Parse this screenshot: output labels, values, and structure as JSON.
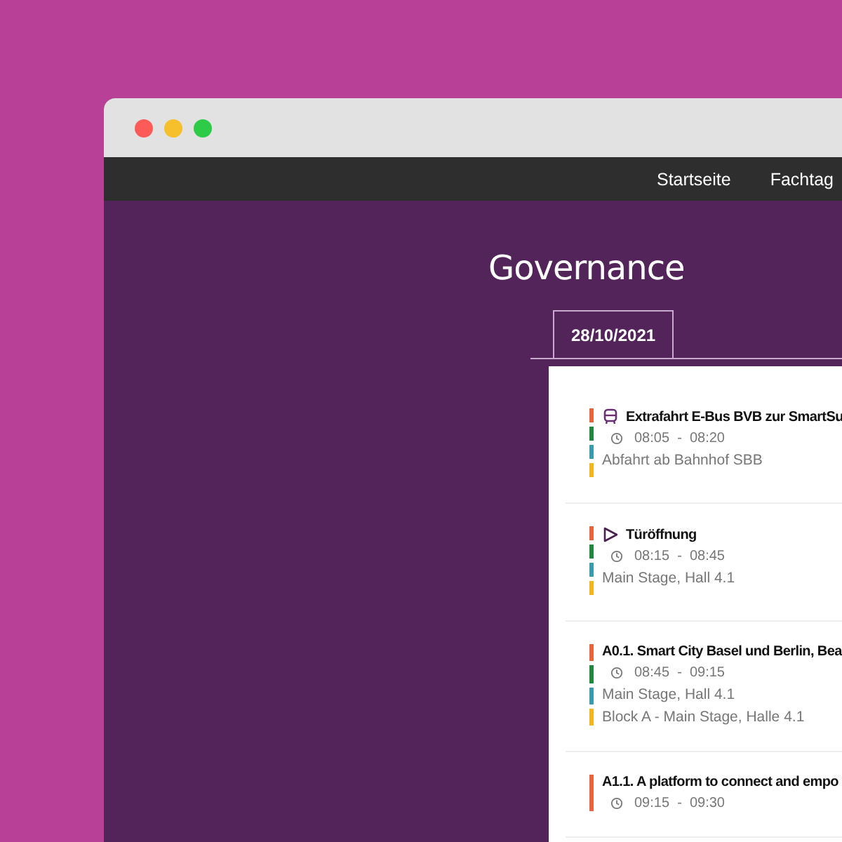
{
  "nav": {
    "items": [
      {
        "label": "Startseite"
      },
      {
        "label": "Fachtag"
      }
    ]
  },
  "page": {
    "title": "Governance"
  },
  "tabs": [
    {
      "label": "28/10/2021",
      "selected": true
    }
  ],
  "events": [
    {
      "kind": "bus",
      "title": "Extrafahrt E-Bus BVB zur SmartSu",
      "time": "08:05  -  08:20",
      "locations": [
        "Abfahrt ab Bahnhof SBB"
      ],
      "tags": [
        {
          "color": "#e8643c"
        },
        {
          "color": "#1e8a3a"
        },
        {
          "color": "#3a9ab0"
        },
        {
          "color": "#f0b81e"
        }
      ]
    },
    {
      "kind": "play",
      "title": "Türöffnung",
      "time": "08:15  -  08:45",
      "locations": [
        "Main Stage, Hall 4.1"
      ],
      "tags": [
        {
          "color": "#e8643c"
        },
        {
          "color": "#1e8a3a"
        },
        {
          "color": "#3a9ab0"
        },
        {
          "color": "#f0b81e"
        }
      ]
    },
    {
      "kind": "talk",
      "title": "A0.1. Smart City Basel und Berlin, Bea",
      "time": "08:45  -  09:15",
      "locations": [
        "Main Stage, Hall 4.1",
        "Block A - Main Stage, Halle 4.1"
      ],
      "tags": [
        {
          "color": "#e8643c"
        },
        {
          "color": "#1e8a3a"
        },
        {
          "color": "#3a9ab0"
        },
        {
          "color": "#f0b81e"
        }
      ]
    },
    {
      "kind": "talk",
      "title": "A1.1. A platform to connect and empo",
      "time": "09:15  -  09:30",
      "tags": [
        {
          "color": "#e8643c"
        }
      ]
    }
  ]
}
